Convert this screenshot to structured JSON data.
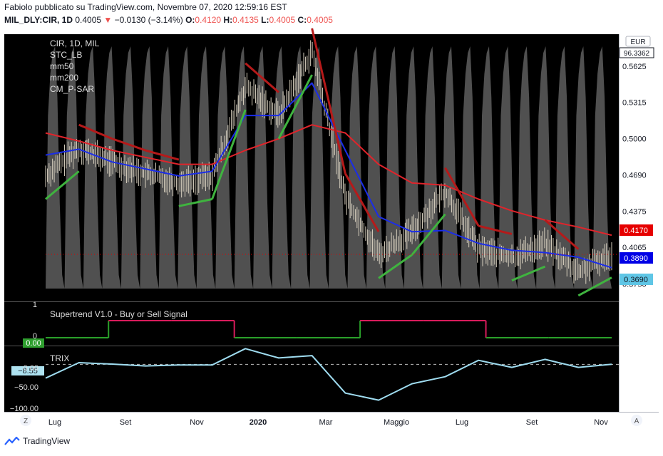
{
  "header": {
    "author_line": "Fabiolo pubblicato su TradingView.com, Novembre 07, 2020 12:59:16 EST",
    "symbol": "MIL_DLY:CIR, 1D",
    "last": "0.4005",
    "change": "−0.0130 (−3.14%)",
    "o_label": "O:",
    "o_val": "0.4120",
    "h_label": "H:",
    "h_val": "0.4135",
    "l_label": "L:",
    "l_val": "0.4005",
    "c_label": "C:",
    "c_val": "0.4005"
  },
  "legend": {
    "title": "CIR, 1D, MIL",
    "items": [
      "STC_LB",
      "mm50",
      "mm200",
      "CM_P-SAR"
    ]
  },
  "price_axis": {
    "currency": "EUR",
    "ticks": [
      "0.5625",
      "0.5315",
      "0.5000",
      "0.4690",
      "0.4375",
      "0.4065",
      "0.3750"
    ],
    "tags": {
      "top": "96.3362",
      "mm200": "0.4170",
      "mm50": "0.3890",
      "last": "0.3690"
    }
  },
  "supertrend": {
    "label": "Supertrend V1.0 - Buy or Sell Signal",
    "ticks": [
      "1",
      "0"
    ],
    "tag": "0.00"
  },
  "trix": {
    "label": "TRIX",
    "ticks": [
      "0.00",
      "−50.00",
      "−100.00"
    ],
    "tag": "−8.55"
  },
  "time_axis": [
    "Lug",
    "Set",
    "Nov",
    "2020",
    "Mar",
    "Maggio",
    "Lug",
    "Set",
    "Nov"
  ],
  "footer": {
    "brand": "TradingView",
    "left_btn": "Z",
    "right_btn": "A"
  },
  "colors": {
    "panel_bg": "#000000",
    "mm200": "#e0242b",
    "mm50": "#1b2de8",
    "psar_up": "#3fb33f",
    "psar_dn": "#b51a1a",
    "stc": "#5e5e5e",
    "supertrend_up": "#2aa02a",
    "supertrend_dn": "#d81b5b",
    "trix": "#9fdcf0",
    "price_bar": "#d8d0bf"
  },
  "chart_data": [
    {
      "type": "line",
      "title": "CIR, 1D, MIL",
      "x": [
        "2019-06",
        "2019-07",
        "2019-08",
        "2019-09",
        "2019-10",
        "2019-11",
        "2019-12",
        "2020-01",
        "2020-02",
        "2020-03",
        "2020-04",
        "2020-05",
        "2020-06",
        "2020-07",
        "2020-08",
        "2020-09",
        "2020-10",
        "2020-11"
      ],
      "series": [
        {
          "name": "CIR",
          "values": [
            0.468,
            0.492,
            0.48,
            0.47,
            0.462,
            0.468,
            0.545,
            0.52,
            0.575,
            0.45,
            0.4,
            0.42,
            0.455,
            0.405,
            0.398,
            0.41,
            0.385,
            0.4005
          ]
        },
        {
          "name": "mm50",
          "values": [
            0.486,
            0.491,
            0.48,
            0.474,
            0.468,
            0.472,
            0.52,
            0.52,
            0.548,
            0.49,
            0.433,
            0.42,
            0.421,
            0.41,
            0.404,
            0.402,
            0.398,
            0.389
          ]
        },
        {
          "name": "mm200",
          "values": [
            0.505,
            0.498,
            0.49,
            0.484,
            0.478,
            0.478,
            0.49,
            0.5,
            0.512,
            0.505,
            0.478,
            0.462,
            0.46,
            0.448,
            0.438,
            0.43,
            0.424,
            0.417
          ]
        }
      ],
      "ylim": [
        0.36,
        0.59
      ],
      "grid": false
    },
    {
      "type": "line",
      "title": "Supertrend V1.0 - Buy or Sell Signal",
      "x": [
        "2019-06",
        "2019-08",
        "2019-10",
        "2019-12",
        "2020-02",
        "2020-03",
        "2020-05",
        "2020-07",
        "2020-09",
        "2020-11"
      ],
      "series": [
        {
          "name": "Supertrend",
          "values": [
            0,
            1,
            1,
            0,
            0,
            1,
            1,
            0,
            0,
            0
          ]
        }
      ],
      "ylim": [
        0,
        1
      ]
    },
    {
      "type": "line",
      "title": "TRIX",
      "x": [
        "2019-06",
        "2019-07",
        "2019-08",
        "2019-09",
        "2019-10",
        "2019-11",
        "2019-12",
        "2020-01",
        "2020-02",
        "2020-03",
        "2020-04",
        "2020-05",
        "2020-06",
        "2020-07",
        "2020-08",
        "2020-09",
        "2020-10",
        "2020-11"
      ],
      "series": [
        {
          "name": "TRIX",
          "values": [
            -38,
            -5,
            -8,
            -12,
            -10,
            -10,
            25,
            5,
            10,
            -70,
            -85,
            -50,
            -35,
            0,
            -15,
            2,
            -15,
            -8.55
          ]
        }
      ],
      "ylim": [
        -110,
        30
      ]
    }
  ]
}
